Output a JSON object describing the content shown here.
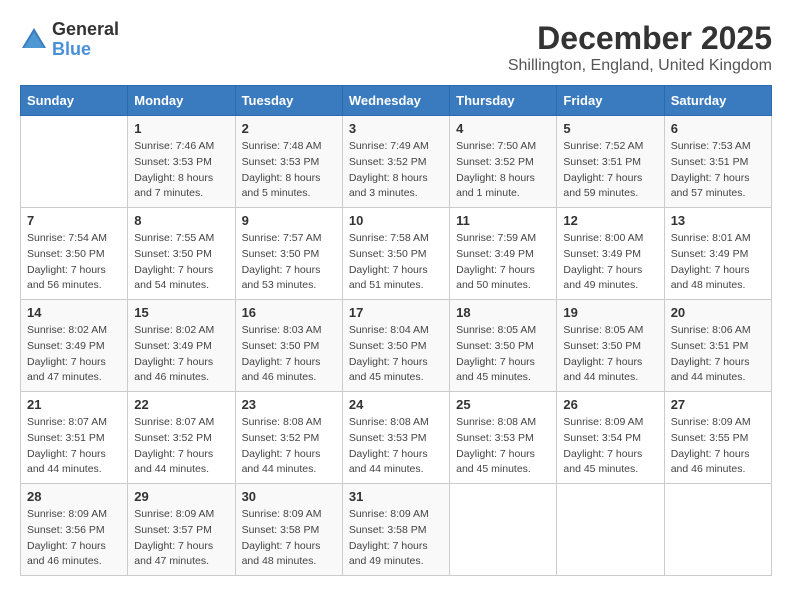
{
  "logo": {
    "general": "General",
    "blue": "Blue"
  },
  "title": "December 2025",
  "location": "Shillington, England, United Kingdom",
  "days_of_week": [
    "Sunday",
    "Monday",
    "Tuesday",
    "Wednesday",
    "Thursday",
    "Friday",
    "Saturday"
  ],
  "weeks": [
    [
      {
        "day": "",
        "sunrise": "",
        "sunset": "",
        "daylight": ""
      },
      {
        "day": "1",
        "sunrise": "Sunrise: 7:46 AM",
        "sunset": "Sunset: 3:53 PM",
        "daylight": "Daylight: 8 hours and 7 minutes."
      },
      {
        "day": "2",
        "sunrise": "Sunrise: 7:48 AM",
        "sunset": "Sunset: 3:53 PM",
        "daylight": "Daylight: 8 hours and 5 minutes."
      },
      {
        "day": "3",
        "sunrise": "Sunrise: 7:49 AM",
        "sunset": "Sunset: 3:52 PM",
        "daylight": "Daylight: 8 hours and 3 minutes."
      },
      {
        "day": "4",
        "sunrise": "Sunrise: 7:50 AM",
        "sunset": "Sunset: 3:52 PM",
        "daylight": "Daylight: 8 hours and 1 minute."
      },
      {
        "day": "5",
        "sunrise": "Sunrise: 7:52 AM",
        "sunset": "Sunset: 3:51 PM",
        "daylight": "Daylight: 7 hours and 59 minutes."
      },
      {
        "day": "6",
        "sunrise": "Sunrise: 7:53 AM",
        "sunset": "Sunset: 3:51 PM",
        "daylight": "Daylight: 7 hours and 57 minutes."
      }
    ],
    [
      {
        "day": "7",
        "sunrise": "Sunrise: 7:54 AM",
        "sunset": "Sunset: 3:50 PM",
        "daylight": "Daylight: 7 hours and 56 minutes."
      },
      {
        "day": "8",
        "sunrise": "Sunrise: 7:55 AM",
        "sunset": "Sunset: 3:50 PM",
        "daylight": "Daylight: 7 hours and 54 minutes."
      },
      {
        "day": "9",
        "sunrise": "Sunrise: 7:57 AM",
        "sunset": "Sunset: 3:50 PM",
        "daylight": "Daylight: 7 hours and 53 minutes."
      },
      {
        "day": "10",
        "sunrise": "Sunrise: 7:58 AM",
        "sunset": "Sunset: 3:50 PM",
        "daylight": "Daylight: 7 hours and 51 minutes."
      },
      {
        "day": "11",
        "sunrise": "Sunrise: 7:59 AM",
        "sunset": "Sunset: 3:49 PM",
        "daylight": "Daylight: 7 hours and 50 minutes."
      },
      {
        "day": "12",
        "sunrise": "Sunrise: 8:00 AM",
        "sunset": "Sunset: 3:49 PM",
        "daylight": "Daylight: 7 hours and 49 minutes."
      },
      {
        "day": "13",
        "sunrise": "Sunrise: 8:01 AM",
        "sunset": "Sunset: 3:49 PM",
        "daylight": "Daylight: 7 hours and 48 minutes."
      }
    ],
    [
      {
        "day": "14",
        "sunrise": "Sunrise: 8:02 AM",
        "sunset": "Sunset: 3:49 PM",
        "daylight": "Daylight: 7 hours and 47 minutes."
      },
      {
        "day": "15",
        "sunrise": "Sunrise: 8:02 AM",
        "sunset": "Sunset: 3:49 PM",
        "daylight": "Daylight: 7 hours and 46 minutes."
      },
      {
        "day": "16",
        "sunrise": "Sunrise: 8:03 AM",
        "sunset": "Sunset: 3:50 PM",
        "daylight": "Daylight: 7 hours and 46 minutes."
      },
      {
        "day": "17",
        "sunrise": "Sunrise: 8:04 AM",
        "sunset": "Sunset: 3:50 PM",
        "daylight": "Daylight: 7 hours and 45 minutes."
      },
      {
        "day": "18",
        "sunrise": "Sunrise: 8:05 AM",
        "sunset": "Sunset: 3:50 PM",
        "daylight": "Daylight: 7 hours and 45 minutes."
      },
      {
        "day": "19",
        "sunrise": "Sunrise: 8:05 AM",
        "sunset": "Sunset: 3:50 PM",
        "daylight": "Daylight: 7 hours and 44 minutes."
      },
      {
        "day": "20",
        "sunrise": "Sunrise: 8:06 AM",
        "sunset": "Sunset: 3:51 PM",
        "daylight": "Daylight: 7 hours and 44 minutes."
      }
    ],
    [
      {
        "day": "21",
        "sunrise": "Sunrise: 8:07 AM",
        "sunset": "Sunset: 3:51 PM",
        "daylight": "Daylight: 7 hours and 44 minutes."
      },
      {
        "day": "22",
        "sunrise": "Sunrise: 8:07 AM",
        "sunset": "Sunset: 3:52 PM",
        "daylight": "Daylight: 7 hours and 44 minutes."
      },
      {
        "day": "23",
        "sunrise": "Sunrise: 8:08 AM",
        "sunset": "Sunset: 3:52 PM",
        "daylight": "Daylight: 7 hours and 44 minutes."
      },
      {
        "day": "24",
        "sunrise": "Sunrise: 8:08 AM",
        "sunset": "Sunset: 3:53 PM",
        "daylight": "Daylight: 7 hours and 44 minutes."
      },
      {
        "day": "25",
        "sunrise": "Sunrise: 8:08 AM",
        "sunset": "Sunset: 3:53 PM",
        "daylight": "Daylight: 7 hours and 45 minutes."
      },
      {
        "day": "26",
        "sunrise": "Sunrise: 8:09 AM",
        "sunset": "Sunset: 3:54 PM",
        "daylight": "Daylight: 7 hours and 45 minutes."
      },
      {
        "day": "27",
        "sunrise": "Sunrise: 8:09 AM",
        "sunset": "Sunset: 3:55 PM",
        "daylight": "Daylight: 7 hours and 46 minutes."
      }
    ],
    [
      {
        "day": "28",
        "sunrise": "Sunrise: 8:09 AM",
        "sunset": "Sunset: 3:56 PM",
        "daylight": "Daylight: 7 hours and 46 minutes."
      },
      {
        "day": "29",
        "sunrise": "Sunrise: 8:09 AM",
        "sunset": "Sunset: 3:57 PM",
        "daylight": "Daylight: 7 hours and 47 minutes."
      },
      {
        "day": "30",
        "sunrise": "Sunrise: 8:09 AM",
        "sunset": "Sunset: 3:58 PM",
        "daylight": "Daylight: 7 hours and 48 minutes."
      },
      {
        "day": "31",
        "sunrise": "Sunrise: 8:09 AM",
        "sunset": "Sunset: 3:58 PM",
        "daylight": "Daylight: 7 hours and 49 minutes."
      },
      {
        "day": "",
        "sunrise": "",
        "sunset": "",
        "daylight": ""
      },
      {
        "day": "",
        "sunrise": "",
        "sunset": "",
        "daylight": ""
      },
      {
        "day": "",
        "sunrise": "",
        "sunset": "",
        "daylight": ""
      }
    ]
  ]
}
